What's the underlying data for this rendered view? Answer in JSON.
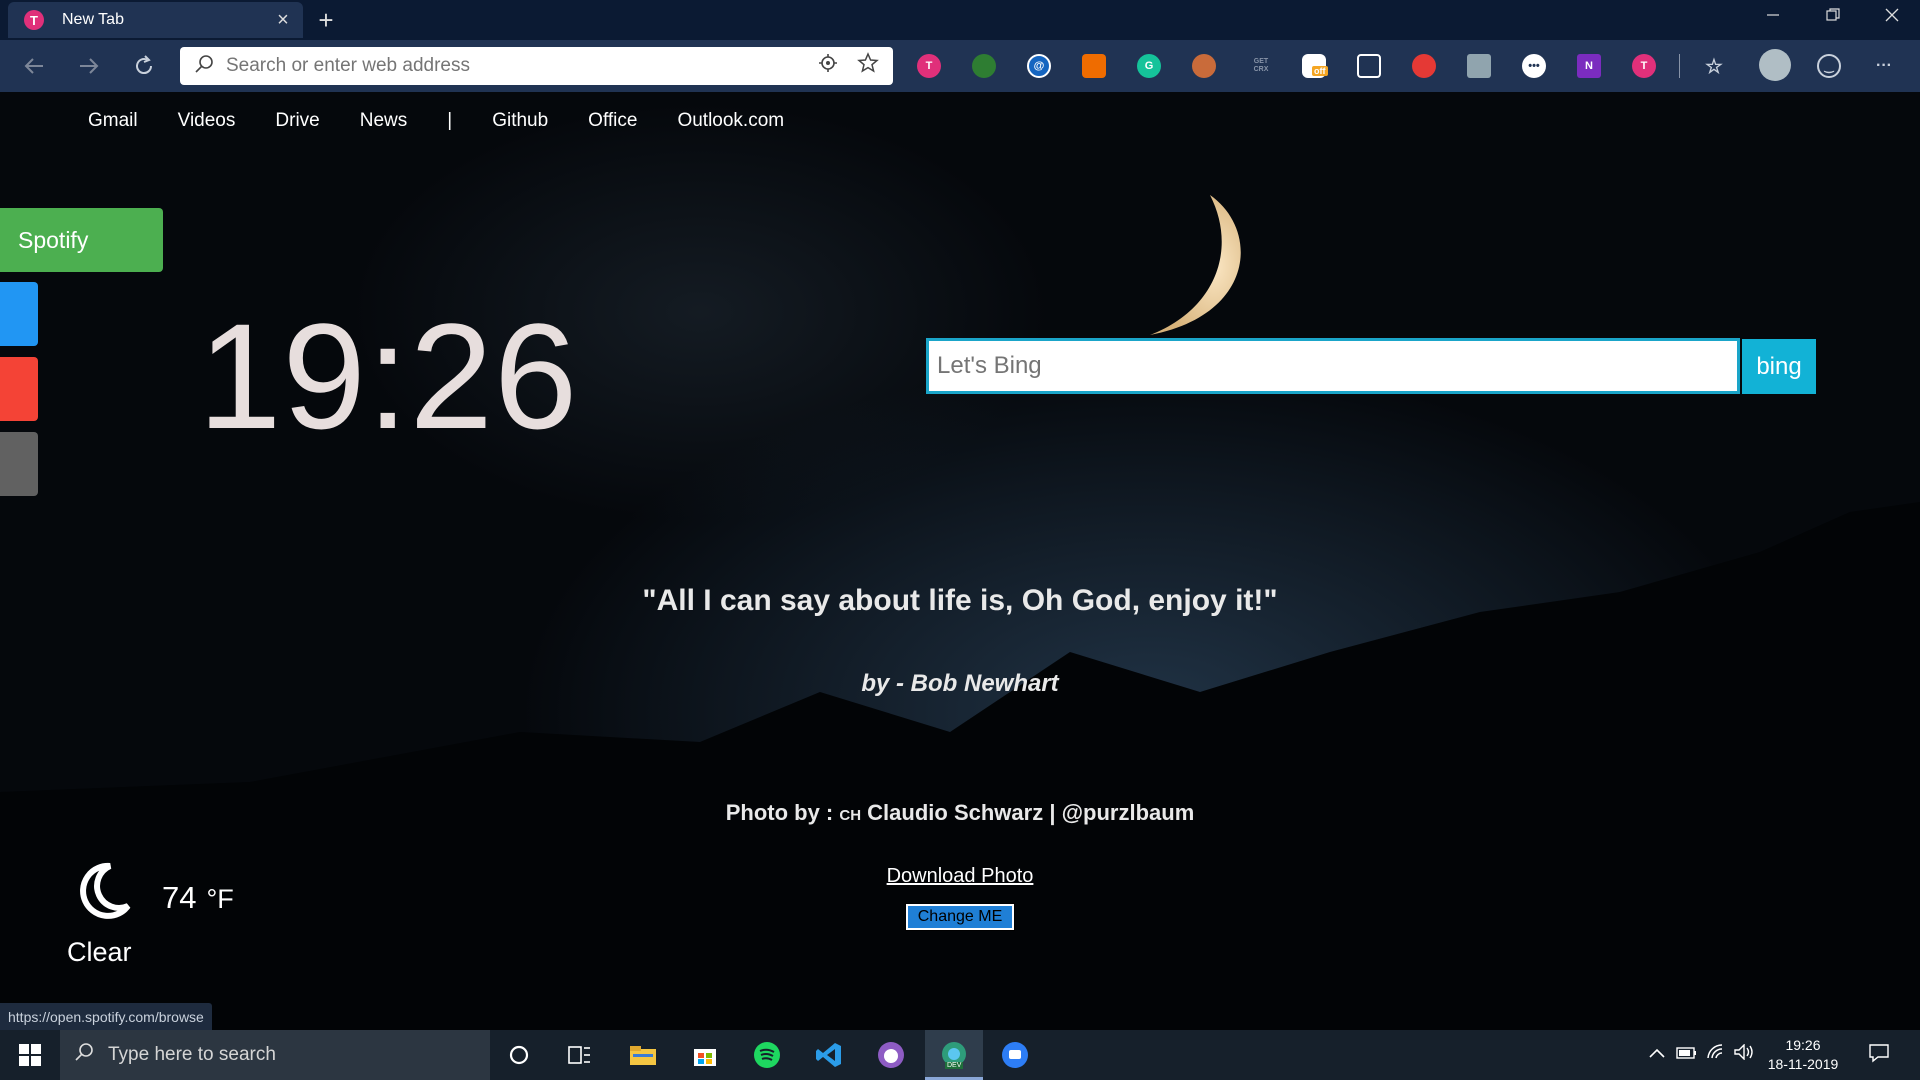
{
  "browser": {
    "tab_title": "New Tab",
    "tab_favicon": "T",
    "close_glyph": "×",
    "new_tab_glyph": "+",
    "address_placeholder": "Search or enter web address",
    "status_url": "https://open.spotify.com/browse",
    "extension_labels": {
      "getcrx": "GET CRX",
      "off_badge": "off"
    }
  },
  "top_links": [
    "Gmail",
    "Videos",
    "Drive",
    "News",
    "|",
    "Github",
    "Office",
    "Outlook.com"
  ],
  "sidebar": {
    "spotify_label": "Spotify",
    "boxes": [
      {
        "color": "#2196f3"
      },
      {
        "color": "#f44336"
      },
      {
        "color": "#616161"
      }
    ]
  },
  "clock": "19:26",
  "search": {
    "placeholder": "Let's Bing",
    "button_label": "bing"
  },
  "quote": {
    "text": "\"All I can say about life is, Oh God, enjoy it!\"",
    "author": "by - Bob Newhart"
  },
  "photo_credit": {
    "prefix": "Photo by : ",
    "flag": "CH",
    "name": "Claudio Schwarz | @purzlbaum",
    "download_label": "Download Photo",
    "change_label": "Change ME"
  },
  "weather": {
    "icon": "moon-icon",
    "temp": "74",
    "unit": "°F",
    "condition": "Clear"
  },
  "taskbar": {
    "search_placeholder": "Type here to search",
    "time": "19:26",
    "date": "18-11-2019",
    "edge_badge": "DEV"
  },
  "colors": {
    "spotify_green": "#4caf50",
    "bing_accent": "#12b2d6",
    "chrome_bg": "#203353"
  }
}
